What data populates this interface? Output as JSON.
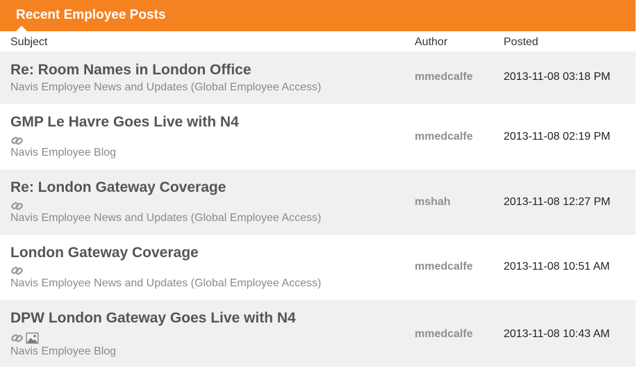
{
  "widget": {
    "title": "Recent Employee Posts"
  },
  "columns": {
    "subject": "Subject",
    "author": "Author",
    "posted": "Posted"
  },
  "posts": [
    {
      "subject": "Re: Room Names in London Office",
      "board": "Navis Employee News and Updates (Global Employee Access)",
      "author": "mmedcalfe",
      "posted": "2013-11-08 03:18 PM",
      "icons": []
    },
    {
      "subject": "GMP Le Havre Goes Live with N4",
      "board": "Navis Employee Blog",
      "author": "mmedcalfe",
      "posted": "2013-11-08 02:19 PM",
      "icons": [
        "link-icon"
      ]
    },
    {
      "subject": "Re: London Gateway Coverage",
      "board": "Navis Employee News and Updates (Global Employee Access)",
      "author": "mshah",
      "posted": "2013-11-08 12:27 PM",
      "icons": [
        "link-icon"
      ]
    },
    {
      "subject": "London Gateway Coverage",
      "board": "Navis Employee News and Updates (Global Employee Access)",
      "author": "mmedcalfe",
      "posted": "2013-11-08 10:51 AM",
      "icons": [
        "link-icon"
      ]
    },
    {
      "subject": "DPW London Gateway Goes Live with N4",
      "board": "Navis Employee Blog",
      "author": "mmedcalfe",
      "posted": "2013-11-08 10:43 AM",
      "icons": [
        "link-icon",
        "image-icon"
      ]
    }
  ]
}
